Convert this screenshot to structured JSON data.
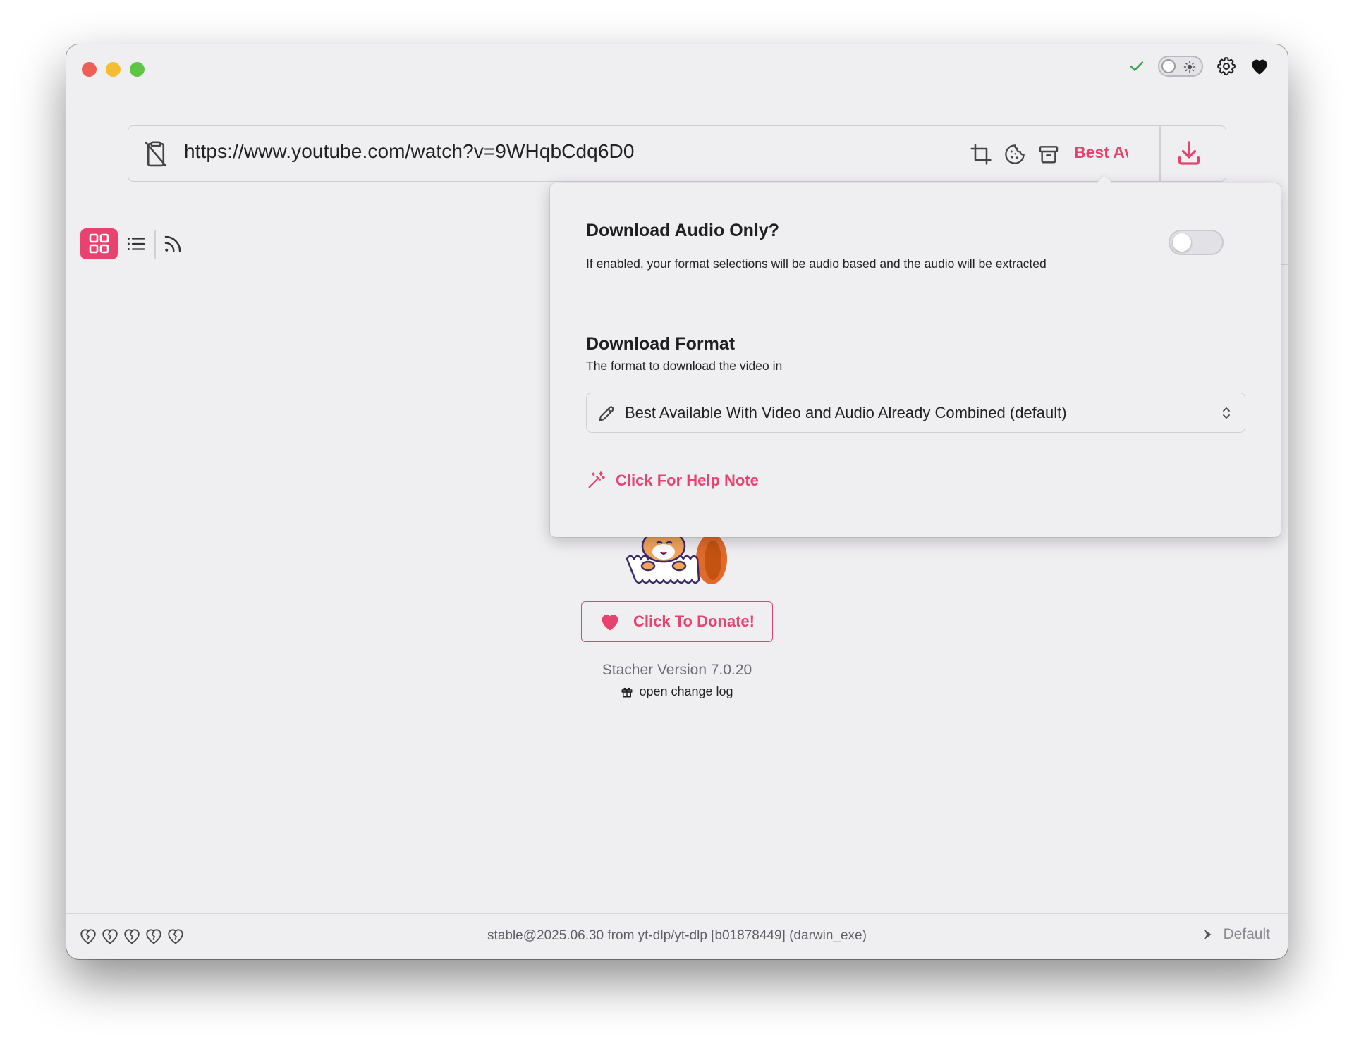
{
  "url_bar": {
    "url": "https://www.youtube.com/watch?v=9WHqbCdq6D0",
    "format_short": "Best Available"
  },
  "popover": {
    "audio_title": "Download Audio Only?",
    "audio_description": "If enabled, your format selections will be audio based and the audio will be extracted",
    "audio_only_enabled": false,
    "format_title": "Download Format",
    "format_description": "The format to download the video in",
    "format_selected": "Best Available With Video and Audio Already Combined (default)",
    "help_link": "Click For Help Note"
  },
  "main": {
    "donate_label": "Click To Donate!",
    "version": "Stacher Version 7.0.20",
    "changelog": "open change log"
  },
  "footer": {
    "status": "stable@2025.06.30 from yt-dlp/yt-dlp [b01878449] (darwin_exe)",
    "profile": "Default"
  },
  "colors": {
    "accent": "#e8436f",
    "window_bg": "#efeef1",
    "check": "#3aa24a"
  },
  "icons": [
    "check-icon",
    "theme-toggle-sun-icon",
    "gear-icon",
    "heart-icon",
    "clipboard-off-icon",
    "crop-icon",
    "cookie-icon",
    "archive-icon",
    "download-icon",
    "grid-view-icon",
    "list-view-icon",
    "rss-icon",
    "pencil-icon",
    "chevron-updown-icon",
    "magic-wand-icon",
    "gift-icon",
    "broken-heart-icon",
    "chevron-right-icon"
  ]
}
